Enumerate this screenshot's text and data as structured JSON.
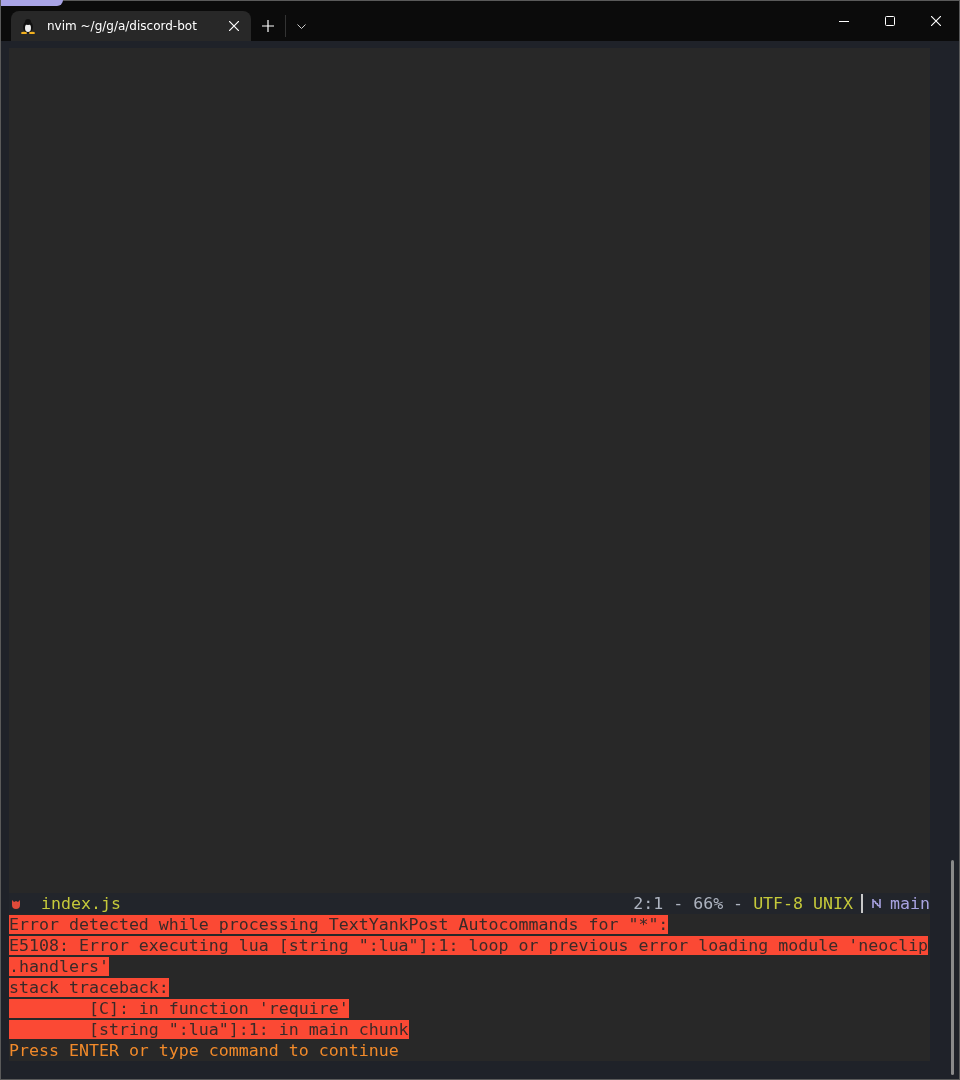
{
  "tab": {
    "title": "nvim ~/g/g/a/discord-bot",
    "selected": true
  },
  "status_line": {
    "filename": "index.js",
    "position": "2:1 - 66% -",
    "encoding": "UTF-8 UNIX",
    "branch": "main"
  },
  "messages": [
    {
      "kind": "error",
      "text": "Error detected while processing TextYankPost Autocommands for \"*\":"
    },
    {
      "kind": "error",
      "text": "E5108: Error executing lua [string \":lua\"]:1: loop or previous error loading module 'neoclip"
    },
    {
      "kind": "error",
      "text": ".handlers'"
    },
    {
      "kind": "error",
      "text": "stack traceback:"
    },
    {
      "kind": "error",
      "text": "        [C]: in function 'require'"
    },
    {
      "kind": "error",
      "text": "        [string \":lua\"]:1: in main chunk"
    },
    {
      "kind": "prompt",
      "text": "Press ENTER or type command to continue"
    }
  ]
}
